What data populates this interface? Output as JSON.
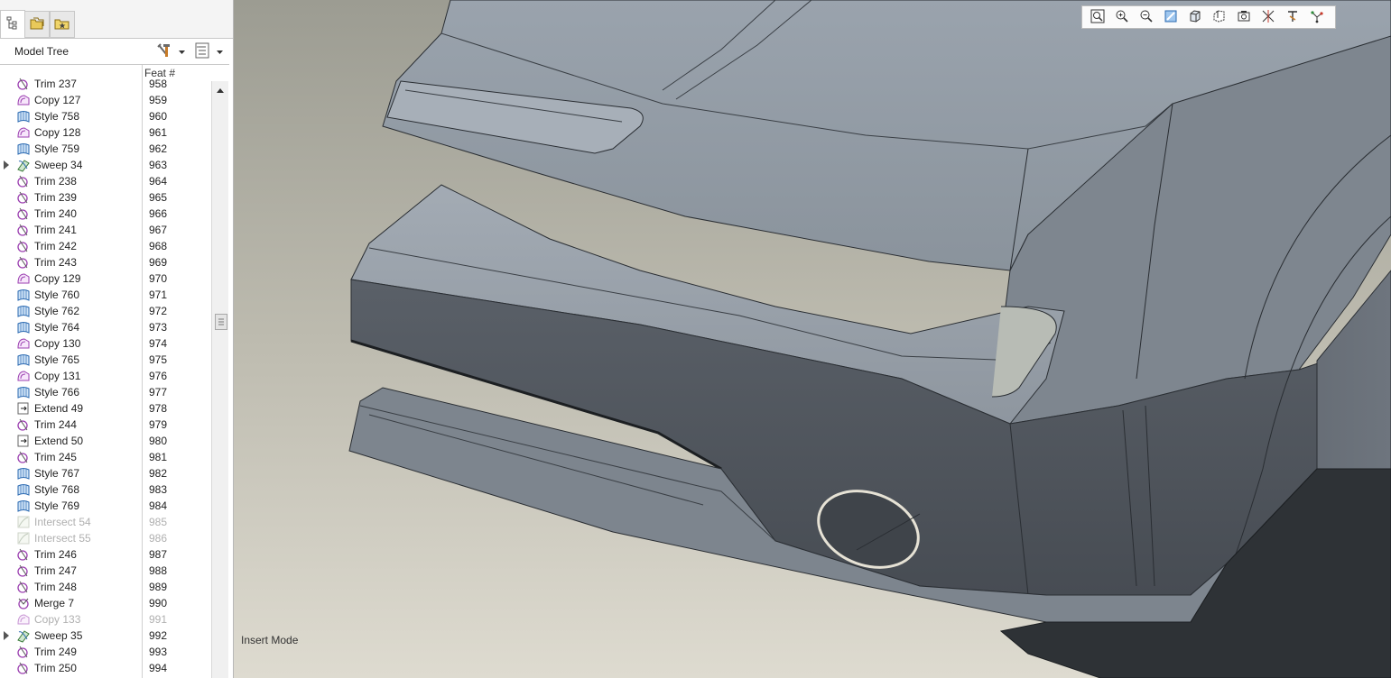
{
  "panel": {
    "tabs": [
      {
        "name": "model-tree-tab-icon",
        "active": true
      },
      {
        "name": "folder-browser-tab-icon",
        "active": false
      },
      {
        "name": "favorites-tab-icon",
        "active": false
      }
    ],
    "title": "Model Tree",
    "columns": {
      "feat_number": "Feat #"
    }
  },
  "tree": {
    "partial_top": {
      "label": "Trim 237",
      "num": "958",
      "icon": "trim-icon"
    },
    "rows": [
      {
        "label": "Copy 127",
        "num": "959",
        "icon": "copy-icon"
      },
      {
        "label": "Style 758",
        "num": "960",
        "icon": "style-icon"
      },
      {
        "label": "Copy 128",
        "num": "961",
        "icon": "copy-icon"
      },
      {
        "label": "Style 759",
        "num": "962",
        "icon": "style-icon"
      },
      {
        "label": "Sweep 34",
        "num": "963",
        "icon": "sweep-icon",
        "expandable": true
      },
      {
        "label": "Trim 238",
        "num": "964",
        "icon": "trim-icon"
      },
      {
        "label": "Trim 239",
        "num": "965",
        "icon": "trim-icon"
      },
      {
        "label": "Trim 240",
        "num": "966",
        "icon": "trim-icon"
      },
      {
        "label": "Trim 241",
        "num": "967",
        "icon": "trim-icon"
      },
      {
        "label": "Trim 242",
        "num": "968",
        "icon": "trim-icon"
      },
      {
        "label": "Trim 243",
        "num": "969",
        "icon": "trim-icon"
      },
      {
        "label": "Copy 129",
        "num": "970",
        "icon": "copy-icon"
      },
      {
        "label": "Style 760",
        "num": "971",
        "icon": "style-icon"
      },
      {
        "label": "Style 762",
        "num": "972",
        "icon": "style-icon"
      },
      {
        "label": "Style 764",
        "num": "973",
        "icon": "style-icon"
      },
      {
        "label": "Copy 130",
        "num": "974",
        "icon": "copy-icon"
      },
      {
        "label": "Style 765",
        "num": "975",
        "icon": "style-icon"
      },
      {
        "label": "Copy 131",
        "num": "976",
        "icon": "copy-icon"
      },
      {
        "label": "Style 766",
        "num": "977",
        "icon": "style-icon"
      },
      {
        "label": "Extend 49",
        "num": "978",
        "icon": "extend-icon"
      },
      {
        "label": "Trim 244",
        "num": "979",
        "icon": "trim-icon"
      },
      {
        "label": "Extend 50",
        "num": "980",
        "icon": "extend-icon"
      },
      {
        "label": "Trim 245",
        "num": "981",
        "icon": "trim-icon"
      },
      {
        "label": "Style 767",
        "num": "982",
        "icon": "style-icon"
      },
      {
        "label": "Style 768",
        "num": "983",
        "icon": "style-icon"
      },
      {
        "label": "Style 769",
        "num": "984",
        "icon": "style-icon"
      },
      {
        "label": "Intersect 54",
        "num": "985",
        "icon": "intersect-icon",
        "suppressed": true
      },
      {
        "label": "Intersect 55",
        "num": "986",
        "icon": "intersect-icon",
        "suppressed": true
      },
      {
        "label": "Trim 246",
        "num": "987",
        "icon": "trim-icon"
      },
      {
        "label": "Trim 247",
        "num": "988",
        "icon": "trim-icon"
      },
      {
        "label": "Trim 248",
        "num": "989",
        "icon": "trim-icon"
      },
      {
        "label": "Merge 7",
        "num": "990",
        "icon": "merge-icon"
      },
      {
        "label": "Copy 133",
        "num": "991",
        "icon": "copy-icon",
        "suppressed": true
      },
      {
        "label": "Sweep 35",
        "num": "992",
        "icon": "sweep-icon",
        "expandable": true
      },
      {
        "label": "Trim 249",
        "num": "993",
        "icon": "trim-icon"
      },
      {
        "label": "Trim 250",
        "num": "994",
        "icon": "trim-icon"
      }
    ]
  },
  "viewport": {
    "status": "Insert Mode",
    "toolbar": [
      "refit-icon",
      "zoom-in-icon",
      "zoom-out-icon",
      "repaint-icon",
      "display-style-icon",
      "saved-views-icon",
      "view-manager-icon",
      "datum-display-icon",
      "annotation-display-icon",
      "spin-center-icon"
    ],
    "background_top": "#9c9c92",
    "background_bottom": "#dedbd0",
    "surface_color": "#8d959e"
  }
}
